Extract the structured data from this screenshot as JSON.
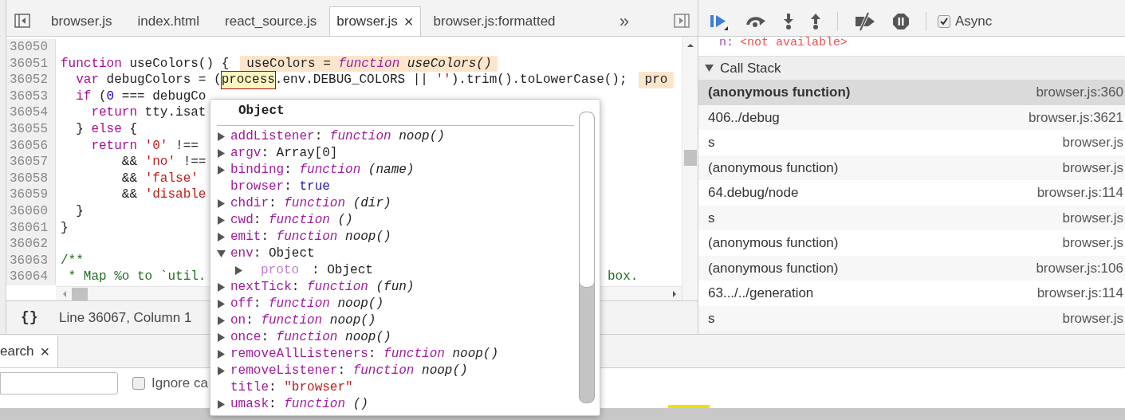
{
  "editor": {
    "tabs": [
      {
        "label": "browser.js",
        "selected": false
      },
      {
        "label": "index.html",
        "selected": false
      },
      {
        "label": "react_source.js",
        "selected": false
      },
      {
        "label": "browser.js",
        "selected": true,
        "close": "×"
      },
      {
        "label": "browser.js:formatted",
        "selected": false
      }
    ],
    "overflow": "»",
    "lines": [
      {
        "number": "36050"
      },
      {
        "number": "36051",
        "tokens": [
          {
            "text": "function",
            "kind": "kw"
          },
          {
            "text": " useColors() {",
            "kind": "plain"
          }
        ],
        "annotation": [
          {
            "text": "useColors = ",
            "kind": "plain"
          },
          {
            "text": "function",
            "kind": "fn"
          },
          {
            "text": " useColors()",
            "kind": "sig"
          }
        ]
      },
      {
        "number": "36052",
        "tokens": [
          {
            "text": "  var",
            "kind": "kw"
          },
          {
            "text": " debugColors = (",
            "kind": "plain"
          },
          {
            "text": "process",
            "kind": "hl"
          },
          {
            "text": ".env.DEBUG_COLORS || ",
            "kind": "plain"
          },
          {
            "text": "''",
            "kind": "str"
          },
          {
            "text": ").trim().toLowerCase();",
            "kind": "plain"
          }
        ],
        "annotation": [
          {
            "text": "pro",
            "kind": "plain"
          }
        ]
      },
      {
        "number": "36053",
        "tokens": [
          {
            "text": "  if",
            "kind": "kw"
          },
          {
            "text": " (",
            "kind": "plain"
          },
          {
            "text": "0",
            "kind": "num"
          },
          {
            "text": " === debugCo",
            "kind": "plain"
          }
        ]
      },
      {
        "number": "36054",
        "tokens": [
          {
            "text": "    return",
            "kind": "kw"
          },
          {
            "text": " tty.isat",
            "kind": "plain"
          }
        ]
      },
      {
        "number": "36055",
        "tokens": [
          {
            "text": "  } ",
            "kind": "plain"
          },
          {
            "text": "else",
            "kind": "kw"
          },
          {
            "text": " {",
            "kind": "plain"
          }
        ]
      },
      {
        "number": "36056",
        "tokens": [
          {
            "text": "    return",
            "kind": "kw"
          },
          {
            "text": " '0'",
            "kind": "str"
          },
          {
            "text": " !==",
            "kind": "plain"
          }
        ]
      },
      {
        "number": "36057",
        "tokens": [
          {
            "text": "        && ",
            "kind": "plain"
          },
          {
            "text": "'no'",
            "kind": "str"
          },
          {
            "text": " !==",
            "kind": "plain"
          }
        ]
      },
      {
        "number": "36058",
        "tokens": [
          {
            "text": "        && ",
            "kind": "plain"
          },
          {
            "text": "'false'",
            "kind": "str"
          }
        ]
      },
      {
        "number": "36059",
        "tokens": [
          {
            "text": "        && ",
            "kind": "plain"
          },
          {
            "text": "'disable",
            "kind": "str"
          }
        ]
      },
      {
        "number": "36060",
        "tokens": [
          {
            "text": "  }",
            "kind": "plain"
          }
        ]
      },
      {
        "number": "36061",
        "tokens": [
          {
            "text": "}",
            "kind": "plain"
          }
        ]
      },
      {
        "number": "36062"
      },
      {
        "number": "36063",
        "tokens": [
          {
            "text": "/**",
            "kind": "comment"
          }
        ]
      },
      {
        "number": "36064",
        "tokens": [
          {
            "text": " * Map %o to `util.",
            "kind": "comment"
          }
        ],
        "tail": "box."
      }
    ],
    "format_button": "{}",
    "status": "Line 36067, Column 1"
  },
  "popover": {
    "title": "Object",
    "properties": [
      {
        "name": "addListener",
        "expanded": false,
        "value": [
          {
            "text": ": ",
            "kind": "plain"
          },
          {
            "text": "function",
            "kind": "fn"
          },
          {
            "text": " noop()",
            "kind": "sig"
          }
        ]
      },
      {
        "name": "argv",
        "expanded": false,
        "value": [
          {
            "text": ": Array[0]",
            "kind": "plain"
          }
        ]
      },
      {
        "name": "binding",
        "expanded": false,
        "value": [
          {
            "text": ": ",
            "kind": "plain"
          },
          {
            "text": "function",
            "kind": "fn"
          },
          {
            "text": " (name)",
            "kind": "sig"
          }
        ]
      },
      {
        "name": "browser",
        "value": [
          {
            "text": ": ",
            "kind": "plain"
          },
          {
            "text": "true",
            "kind": "bool"
          }
        ]
      },
      {
        "name": "chdir",
        "expanded": false,
        "value": [
          {
            "text": ": ",
            "kind": "plain"
          },
          {
            "text": "function",
            "kind": "fn"
          },
          {
            "text": " (dir)",
            "kind": "sig"
          }
        ]
      },
      {
        "name": "cwd",
        "expanded": false,
        "value": [
          {
            "text": ": ",
            "kind": "plain"
          },
          {
            "text": "function",
            "kind": "fn"
          },
          {
            "text": " ()",
            "kind": "sig"
          }
        ]
      },
      {
        "name": "emit",
        "expanded": false,
        "value": [
          {
            "text": ": ",
            "kind": "plain"
          },
          {
            "text": "function",
            "kind": "fn"
          },
          {
            "text": " noop()",
            "kind": "sig"
          }
        ]
      },
      {
        "name": "env",
        "expanded": true,
        "value": [
          {
            "text": ": Object",
            "kind": "plain"
          }
        ],
        "children": [
          {
            "name": "proto",
            "internal": true,
            "expanded": false,
            "value": [
              {
                "text": ": Object",
                "kind": "plain"
              }
            ]
          }
        ]
      },
      {
        "name": "nextTick",
        "expanded": false,
        "value": [
          {
            "text": ": ",
            "kind": "plain"
          },
          {
            "text": "function",
            "kind": "fn"
          },
          {
            "text": " (fun)",
            "kind": "sig"
          }
        ]
      },
      {
        "name": "off",
        "expanded": false,
        "value": [
          {
            "text": ": ",
            "kind": "plain"
          },
          {
            "text": "function",
            "kind": "fn"
          },
          {
            "text": " noop()",
            "kind": "sig"
          }
        ]
      },
      {
        "name": "on",
        "expanded": false,
        "value": [
          {
            "text": ": ",
            "kind": "plain"
          },
          {
            "text": "function",
            "kind": "fn"
          },
          {
            "text": " noop()",
            "kind": "sig"
          }
        ]
      },
      {
        "name": "once",
        "expanded": false,
        "value": [
          {
            "text": ": ",
            "kind": "plain"
          },
          {
            "text": "function",
            "kind": "fn"
          },
          {
            "text": " noop()",
            "kind": "sig"
          }
        ]
      },
      {
        "name": "removeAllListeners",
        "expanded": false,
        "value": [
          {
            "text": ": ",
            "kind": "plain"
          },
          {
            "text": "function",
            "kind": "fn"
          },
          {
            "text": " noop()",
            "kind": "sig"
          }
        ]
      },
      {
        "name": "removeListener",
        "expanded": false,
        "value": [
          {
            "text": ": ",
            "kind": "plain"
          },
          {
            "text": "function",
            "kind": "fn"
          },
          {
            "text": " noop()",
            "kind": "sig"
          }
        ]
      },
      {
        "name": "title",
        "value": [
          {
            "text": ": ",
            "kind": "plain"
          },
          {
            "text": "\"browser\"",
            "kind": "str"
          }
        ]
      },
      {
        "name": "umask",
        "expanded": false,
        "value": [
          {
            "text": ": ",
            "kind": "plain"
          },
          {
            "text": "function",
            "kind": "fn"
          },
          {
            "text": " ()",
            "kind": "sig"
          }
        ]
      }
    ]
  },
  "debugger": {
    "async": {
      "label": "Async",
      "checked": true
    },
    "scope_remnant": {
      "name": "n:",
      "value": "<not available>"
    },
    "call_stack": {
      "title": "Call Stack",
      "expanded": true,
      "frames": [
        {
          "function": "(anonymous function)",
          "location": "browser.js:360",
          "selected": true
        },
        {
          "function": "406../debug",
          "location": "browser.js:3621",
          "selected": false
        },
        {
          "function": "s",
          "location": "browser.js",
          "selected": false
        },
        {
          "function": "(anonymous function)",
          "location": "browser.js",
          "selected": false
        },
        {
          "function": "64.debug/node",
          "location": "browser.js:114",
          "selected": false
        },
        {
          "function": "s",
          "location": "browser.js",
          "selected": false
        },
        {
          "function": "(anonymous function)",
          "location": "browser.js",
          "selected": false
        },
        {
          "function": "(anonymous function)",
          "location": "browser.js:106",
          "selected": false
        },
        {
          "function": "63.../../generation",
          "location": "browser.js:114",
          "selected": false
        },
        {
          "function": "s",
          "location": "browser.js",
          "selected": false
        }
      ]
    }
  },
  "drawer": {
    "tab": {
      "label": "earch",
      "selected": true
    },
    "close": "×",
    "ignore_case": {
      "label": "Ignore ca",
      "checked": false
    }
  }
}
